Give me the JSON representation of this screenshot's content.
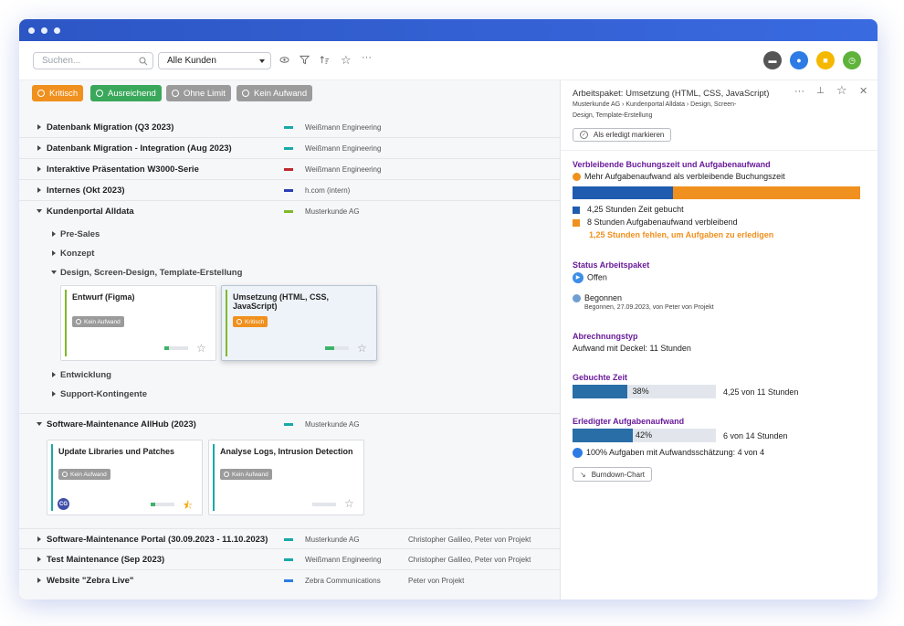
{
  "search": {
    "placeholder": "Suchen..."
  },
  "filter_select": {
    "value": "Alle Kunden"
  },
  "toolbar_icons": [
    "eye-icon",
    "filter-icon",
    "sort-icon",
    "star-icon",
    "more-icon"
  ],
  "header_icons": [
    {
      "name": "folder-icon",
      "color": "#555555"
    },
    {
      "name": "bell-icon",
      "color": "#2d7be5"
    },
    {
      "name": "note-icon",
      "color": "#f5b800"
    },
    {
      "name": "clock-icon",
      "color": "#5fb33a"
    }
  ],
  "filters": [
    {
      "label": "Kritisch",
      "color": "#f0901e"
    },
    {
      "label": "Ausreichend",
      "color": "#3aa85a"
    },
    {
      "label": "Ohne Limit",
      "color": "#9b9b9b"
    },
    {
      "label": "Kein Aufwand",
      "color": "#9b9b9b"
    }
  ],
  "projects_top": [
    {
      "label": "Datenbank Migration (Q3 2023)",
      "customer": "Weißmann Engineering",
      "color": "#1aa8a8"
    },
    {
      "label": "Datenbank Migration - Integration (Aug 2023)",
      "customer": "Weißmann Engineering",
      "color": "#1aa8a8"
    },
    {
      "label": "Interaktive Präsentation W3000-Serie",
      "customer": "Weißmann Engineering",
      "color": "#c0282e"
    },
    {
      "label": "Internes (Okt 2023)",
      "customer": "h.com (intern)",
      "color": "#2a3fb5"
    }
  ],
  "kundenportal": {
    "label": "Kundenportal Alldata",
    "customer": "Musterkunde AG",
    "color": "#7fb82a"
  },
  "sub_items": [
    "Pre-Sales",
    "Konzept",
    "Design, Screen-Design, Template-Erstellung",
    "Entwicklung",
    "Support-Kontingente"
  ],
  "design_cards": [
    {
      "title": "Entwurf (Figma)",
      "badge": "Kein Aufwand",
      "badge_color": "#9b9b9b",
      "progress": 0.2
    },
    {
      "title": "Umsetzung (HTML, CSS, JavaScript)",
      "badge": "Kritisch",
      "badge_color": "#f0901e",
      "progress": 0.38
    }
  ],
  "software_maintenance": {
    "label": "Software-Maintenance AllHub (2023)",
    "customer": "Musterkunde AG",
    "color": "#1aa8a8"
  },
  "maintenance_cards": [
    {
      "title": "Update Libraries und Patches",
      "badge": "Kein Aufwand",
      "avatar": "CG",
      "progress": 0.2
    },
    {
      "title": "Analyse Logs, Intrusion Detection",
      "badge": "Kein Aufwand",
      "progress": 0
    }
  ],
  "projects_bottom": [
    {
      "label": "Software-Maintenance Portal (30.09.2023 - 11.10.2023)",
      "customer": "Musterkunde AG",
      "people": "Christopher Galileo, Peter von Projekt",
      "color": "#1aa8a8"
    },
    {
      "label": "Test Maintenance (Sep 2023)",
      "customer": "Weißmann Engineering",
      "people": "Christopher Galileo, Peter von Projekt",
      "color": "#1aa8a8"
    },
    {
      "label": "Website \"Zebra Live\"",
      "customer": "Zebra Communications",
      "people": "Peter von Projekt",
      "color": "#2d7be5"
    }
  ],
  "detail": {
    "title": "Arbeitspaket: Umsetzung (HTML, CSS, JavaScript)",
    "breadcrumb_1": "Musterkunde AG › Kundenportal Alldata › Design, Screen-",
    "breadcrumb_2": "Design, Template-Erstellung",
    "mark_done": "Als erledigt markieren",
    "remaining_title": "Verbleibende Buchungszeit und Aufgabenaufwand",
    "remaining_warning": "Mehr Aufgabenaufwand als verbleibende Buchungszeit",
    "booked_fraction": 0.35,
    "booked_label": "4,25 Stunden Zeit gebucht",
    "effort_label": "8 Stunden Aufgabenaufwand verbleibend",
    "missing_label": "1,25 Stunden fehlen, um Aufgaben zu erledigen",
    "status_title": "Status Arbeitspaket",
    "status_open": "Offen",
    "status_begun": "Begonnen",
    "status_begun_detail": "Begonnen, 27.09.2023, von Peter von Projekt",
    "billing_title": "Abrechnungstyp",
    "billing_value": "Aufwand mit Deckel: 11 Stunden",
    "booked_title": "Gebuchte Zeit",
    "booked_pct": "38%",
    "booked_progress": 0.38,
    "booked_value": "4,25 von 11 Stunden",
    "done_title": "Erledigter Aufgabenaufwand",
    "done_pct": "42%",
    "done_progress": 0.42,
    "done_value": "6 von 14 Stunden",
    "estimate_label": "100% Aufgaben mit Aufwandsschätzung: 4 von 4",
    "burndown": "Burndown-Chart"
  }
}
